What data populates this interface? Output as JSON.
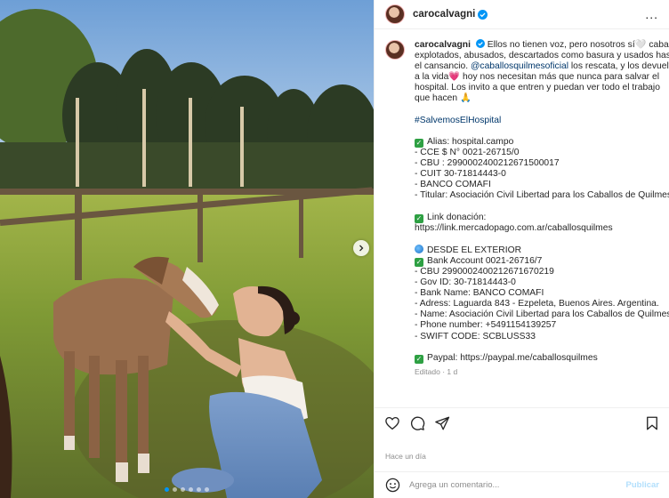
{
  "post": {
    "username": "carocalvagni",
    "more_icon": "...",
    "slides": 6,
    "active_slide": 1
  },
  "caption": {
    "username": "carocalvagni",
    "lines": [
      " Ellos no tienen voz, pero nosotros sí🤍  caballos",
      "explotados, abusados, descartados como basura y usados hasta",
      "el cansancio. "
    ],
    "mention": "@caballosquilmesoficial",
    "after_mention": " los rescata, y los devuelve",
    "line4": "a la vida💗  hoy nos necesitan más que nunca para salvar el",
    "line5": "hospital. Los invito a que entren y puedan ver todo el trabajo",
    "line6": "que hacen 🙏",
    "hashtag": "#SalvemosElHospital",
    "block1": [
      "Alias: hospital.campo",
      "- CCE $ N° 0021-26715/0",
      "- CBU : 2990002400212671500017",
      "- CUIT 30-71814443-0",
      "- BANCO COMAFI",
      "- Titular: Asociación Civil Libertad para los Caballos de Quilmes"
    ],
    "link_label": "Link donación:",
    "link_url": "https://link.mercadopago.com.ar/caballosquilmes",
    "exterior_title": "DESDE EL EXTERIOR",
    "block2": [
      "Bank Account 0021-26716/7",
      "- CBU 2990002400212671670219",
      "- Gov ID: 30-71814443-0",
      "- Bank Name: BANCO COMAFI",
      "- Adress: Laguarda 843 - Ezpeleta, Buenos Aires. Argentina.",
      "- Name: Asociación Civil Libertad para los Caballos de Quilmes",
      "- Phone number: +5491154139257",
      "- SWIFT CODE: SCBLUSS33"
    ],
    "paypal": "Paypal: https://paypal.me/caballosquilmes",
    "meta": "Editado · 1 d"
  },
  "footer": {
    "time_ago": "Hace un día",
    "comment_placeholder": "Agrega un comentario...",
    "publish_label": "Publicar"
  },
  "colors": {
    "link": "#00376b",
    "verified": "#0095f6",
    "publish_disabled": "#b2dffc",
    "muted": "#8e8e8e"
  }
}
